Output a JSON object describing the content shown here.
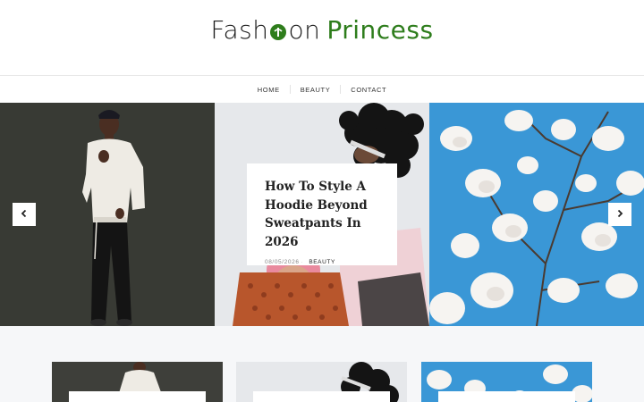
{
  "site": {
    "logo_part1": "Fash",
    "logo_part2": "on",
    "logo_part3": "Princess",
    "accent_color": "#2e7d1c"
  },
  "nav": {
    "items": [
      "HOME",
      "BEAUTY",
      "CONTACT"
    ]
  },
  "slider": {
    "featured": {
      "title": "How To Style A Hoodie Beyond Sweatpants In 2026",
      "date": "08/05/2026",
      "category": "BEAUTY"
    },
    "prev_icon": "chevron-left-icon",
    "next_icon": "chevron-right-icon"
  }
}
